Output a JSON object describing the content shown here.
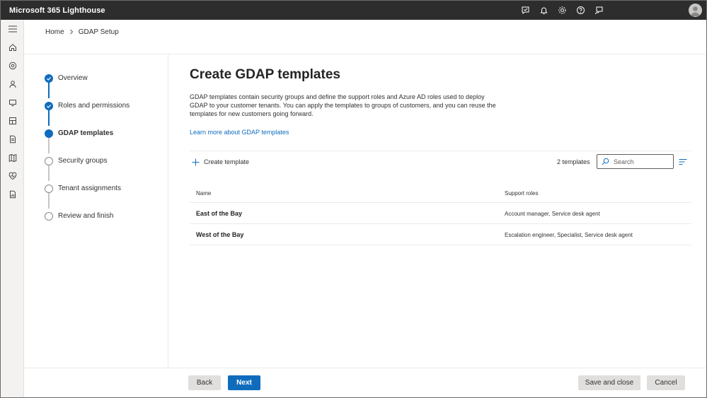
{
  "app": {
    "title": "Microsoft 365 Lighthouse"
  },
  "topbar": {
    "icons": [
      "feedback-icon",
      "bell-icon",
      "gear-icon",
      "help-icon",
      "person-feedback-icon"
    ]
  },
  "rail": {
    "icons": [
      "hamburger-icon",
      "home-icon",
      "tenants-icon",
      "users-icon",
      "devices-icon",
      "dashboard-icon",
      "document-icon",
      "map-icon",
      "health-icon",
      "reports-icon"
    ]
  },
  "breadcrumb": {
    "home": "Home",
    "current": "GDAP Setup"
  },
  "stepper": {
    "steps": [
      {
        "label": "Overview",
        "state": "done"
      },
      {
        "label": "Roles and permissions",
        "state": "done"
      },
      {
        "label": "GDAP templates",
        "state": "current"
      },
      {
        "label": "Security groups",
        "state": "todo"
      },
      {
        "label": "Tenant assignments",
        "state": "todo"
      },
      {
        "label": "Review and finish",
        "state": "todo"
      }
    ]
  },
  "main": {
    "title": "Create GDAP templates",
    "description": "GDAP templates contain security groups and define the support roles and Azure AD roles used to deploy GDAP to your customer tenants. You can apply the templates to groups of customers, and you can reuse the templates for new customers going forward.",
    "learn_link": "Learn more about GDAP templates"
  },
  "toolbar": {
    "create_label": "Create template",
    "count": "2 templates",
    "search_placeholder": "Search"
  },
  "table": {
    "columns": [
      "Name",
      "Support roles"
    ],
    "rows": [
      {
        "name": "East of the Bay",
        "roles": "Account manager, Service desk agent"
      },
      {
        "name": "West of the Bay",
        "roles": "Escalation engineer, Specialist, Service desk agent"
      }
    ]
  },
  "footer": {
    "back": "Back",
    "next": "Next",
    "save_close": "Save and close",
    "cancel": "Cancel"
  },
  "colors": {
    "accent": "#0f6cbd",
    "topbar": "#2d2d2d",
    "rail": "#f3f2f1"
  }
}
